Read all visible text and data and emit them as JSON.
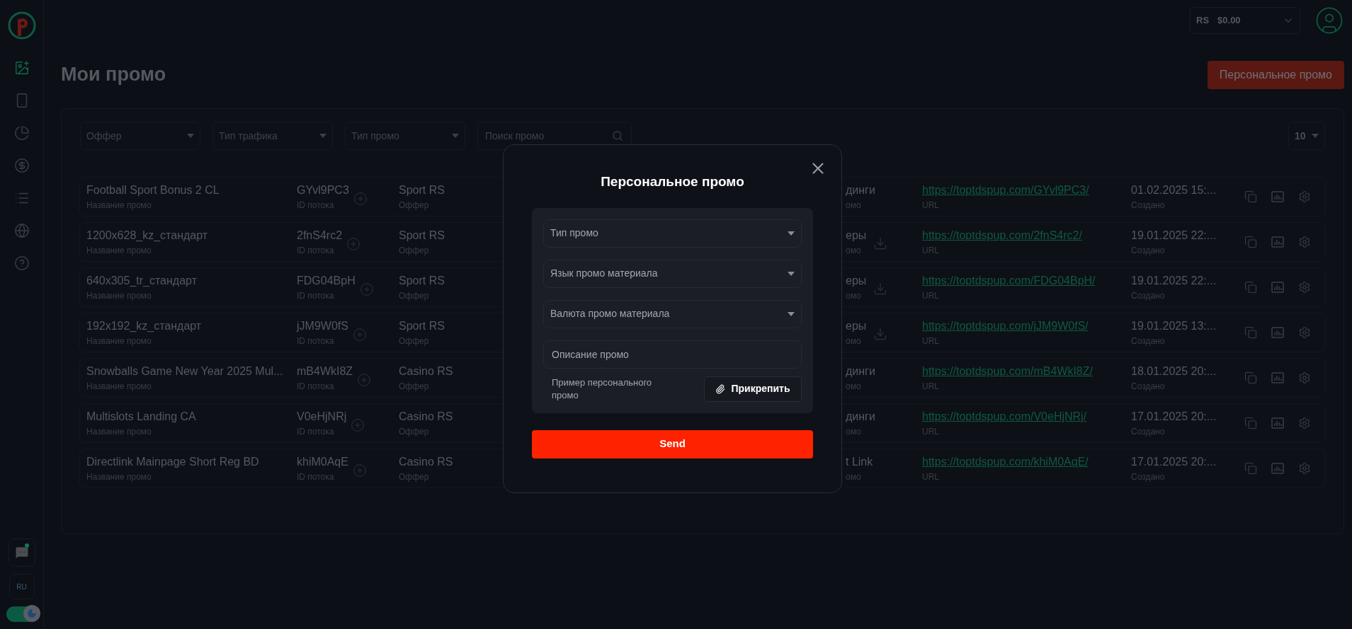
{
  "sidebar": {
    "items": [
      {
        "selected": true
      },
      {
        "selected": false
      },
      {
        "selected": false
      },
      {
        "selected": false
      },
      {
        "selected": false
      },
      {
        "selected": false
      },
      {
        "selected": false
      }
    ],
    "chat": {
      "unread": true
    },
    "language": "RU",
    "dark_mode": true
  },
  "header": {
    "currency": "RS",
    "balance": "$0.00"
  },
  "title": "Мои промо",
  "action_button": "Персональное промо",
  "filters": [
    {
      "kind": "select",
      "placeholder": "Оффер"
    },
    {
      "kind": "select",
      "placeholder": "Тип трафика"
    },
    {
      "kind": "select",
      "placeholder": "Тип промо"
    },
    {
      "kind": "search",
      "placeholder": "Поиск промо"
    }
  ],
  "page_size": "10",
  "rows": [
    {
      "name": "Football Sport Bonus 2 CL",
      "name_label": "Название промо",
      "stream_id": "GYvl9PC3",
      "stream_label": "ID потока",
      "offer": "Sport RS",
      "offer_label": "Оффер",
      "type": "динги",
      "type_label": "омо",
      "downloadable": false,
      "url": "https://toptdspup.com/GYvl9PC3/",
      "url_label": "URL",
      "created": "01.02.2025 15:...",
      "created_label": "Создано"
    },
    {
      "name": "1200x628_kz_стандарт",
      "name_label": "Название промо",
      "stream_id": "2fnS4rc2",
      "stream_label": "ID потока",
      "offer": "Sport RS",
      "offer_label": "Оффер",
      "type": "еры",
      "type_label": "омо",
      "downloadable": true,
      "url": "https://toptdspup.com/2fnS4rc2/",
      "url_label": "URL",
      "created": "19.01.2025 22:...",
      "created_label": "Создано"
    },
    {
      "name": "640x305_tr_стандарт",
      "name_label": "Название промо",
      "stream_id": "FDG04BpH",
      "stream_label": "ID потока",
      "offer": "Sport RS",
      "offer_label": "Оффер",
      "type": "еры",
      "type_label": "омо",
      "downloadable": true,
      "url": "https://toptdspup.com/FDG04BpH/",
      "url_label": "URL",
      "created": "19.01.2025 22:...",
      "created_label": "Создано"
    },
    {
      "name": "192x192_kz_стандарт",
      "name_label": "Название промо",
      "stream_id": "jJM9W0fS",
      "stream_label": "ID потока",
      "offer": "Sport RS",
      "offer_label": "Оффер",
      "type": "еры",
      "type_label": "омо",
      "downloadable": true,
      "url": "https://toptdspup.com/jJM9W0fS/",
      "url_label": "URL",
      "created": "19.01.2025 13:...",
      "created_label": "Создано"
    },
    {
      "name": "Snowballs Game New Year 2025 Mul...",
      "name_label": "Название промо",
      "stream_id": "mB4WkI8Z",
      "stream_label": "ID потока",
      "offer": "Casino RS",
      "offer_label": "Оффер",
      "type": "динги",
      "type_label": "омо",
      "downloadable": false,
      "url": "https://toptdspup.com/mB4WkI8Z/",
      "url_label": "URL",
      "created": "18.01.2025 20:...",
      "created_label": "Создано"
    },
    {
      "name": "Multislots Landing CA",
      "name_label": "Название промо",
      "stream_id": "V0eHjNRj",
      "stream_label": "ID потока",
      "offer": "Casino RS",
      "offer_label": "Оффер",
      "type": "динги",
      "type_label": "омо",
      "downloadable": false,
      "url": "https://toptdspup.com/V0eHjNRj/",
      "url_label": "URL",
      "created": "17.01.2025 20:...",
      "created_label": "Создано"
    },
    {
      "name": "Directlink Mainpage Short Reg BD",
      "name_label": "Название промо",
      "stream_id": "khiM0AqE",
      "stream_label": "ID потока",
      "offer": "Casino RS",
      "offer_label": "Оффер",
      "type": "t Link",
      "type_label": "омо",
      "downloadable": false,
      "url": "https://toptdspup.com/khiM0AqE/",
      "url_label": "URL",
      "created": "17.01.2025 20:...",
      "created_label": "Создано"
    }
  ],
  "modal": {
    "title": "Персональное промо",
    "fields": [
      {
        "kind": "select",
        "placeholder": "Тип промо"
      },
      {
        "kind": "select",
        "placeholder": "Язык промо материала"
      },
      {
        "kind": "select",
        "placeholder": "Валюта промо материала"
      },
      {
        "kind": "text",
        "placeholder": "Описание промо"
      }
    ],
    "attach_label": "Пример персонального промо",
    "attach_button": "Прикрепить",
    "submit": "Send"
  }
}
